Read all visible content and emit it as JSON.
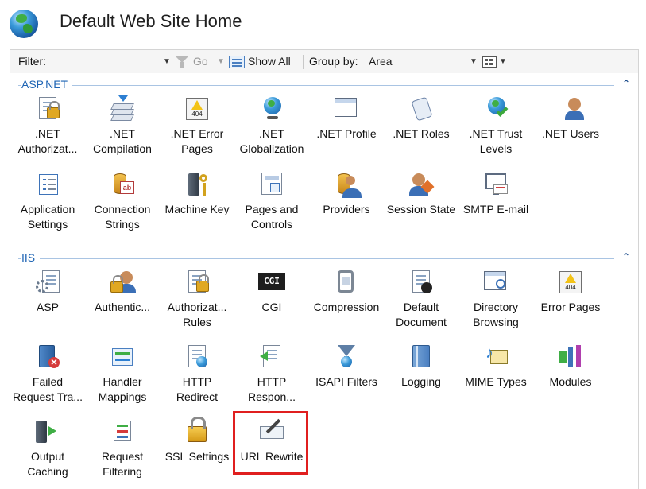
{
  "title": "Default Web Site Home",
  "toolbar": {
    "filter_label": "Filter:",
    "filter_value": "",
    "go_label": "Go",
    "showall_label": "Show All",
    "groupby_label": "Group by:",
    "groupby_value": "Area"
  },
  "groups": [
    {
      "name": "ASP.NET",
      "items": [
        {
          "label": ".NET Authorizat...",
          "icon": "net-authorization-icon"
        },
        {
          "label": ".NET Compilation",
          "icon": "net-compilation-icon"
        },
        {
          "label": ".NET Error Pages",
          "icon": "net-error-pages-icon"
        },
        {
          "label": ".NET Globalization",
          "icon": "net-globalization-icon"
        },
        {
          "label": ".NET Profile",
          "icon": "net-profile-icon"
        },
        {
          "label": ".NET Roles",
          "icon": "net-roles-icon"
        },
        {
          "label": ".NET Trust Levels",
          "icon": "net-trust-levels-icon"
        },
        {
          "label": ".NET Users",
          "icon": "net-users-icon"
        },
        {
          "label": "Application Settings",
          "icon": "application-settings-icon"
        },
        {
          "label": "Connection Strings",
          "icon": "connection-strings-icon"
        },
        {
          "label": "Machine Key",
          "icon": "machine-key-icon"
        },
        {
          "label": "Pages and Controls",
          "icon": "pages-and-controls-icon"
        },
        {
          "label": "Providers",
          "icon": "providers-icon"
        },
        {
          "label": "Session State",
          "icon": "session-state-icon"
        },
        {
          "label": "SMTP E-mail",
          "icon": "smtp-email-icon"
        }
      ]
    },
    {
      "name": "IIS",
      "items": [
        {
          "label": "ASP",
          "icon": "asp-icon"
        },
        {
          "label": "Authentic...",
          "icon": "authentication-icon"
        },
        {
          "label": "Authorizat... Rules",
          "icon": "authorization-rules-icon"
        },
        {
          "label": "CGI",
          "icon": "cgi-icon"
        },
        {
          "label": "Compression",
          "icon": "compression-icon"
        },
        {
          "label": "Default Document",
          "icon": "default-document-icon"
        },
        {
          "label": "Directory Browsing",
          "icon": "directory-browsing-icon"
        },
        {
          "label": "Error Pages",
          "icon": "error-pages-icon"
        },
        {
          "label": "Failed Request Tra...",
          "icon": "failed-request-tracing-icon"
        },
        {
          "label": "Handler Mappings",
          "icon": "handler-mappings-icon"
        },
        {
          "label": "HTTP Redirect",
          "icon": "http-redirect-icon"
        },
        {
          "label": "HTTP Respon...",
          "icon": "http-response-headers-icon"
        },
        {
          "label": "ISAPI Filters",
          "icon": "isapi-filters-icon"
        },
        {
          "label": "Logging",
          "icon": "logging-icon"
        },
        {
          "label": "MIME Types",
          "icon": "mime-types-icon"
        },
        {
          "label": "Modules",
          "icon": "modules-icon"
        },
        {
          "label": "Output Caching",
          "icon": "output-caching-icon"
        },
        {
          "label": "Request Filtering",
          "icon": "request-filtering-icon"
        },
        {
          "label": "SSL Settings",
          "icon": "ssl-settings-icon"
        },
        {
          "label": "URL Rewrite",
          "icon": "url-rewrite-icon"
        }
      ]
    }
  ],
  "highlight": {
    "target": "URL Rewrite",
    "color": "#e01f1f"
  }
}
